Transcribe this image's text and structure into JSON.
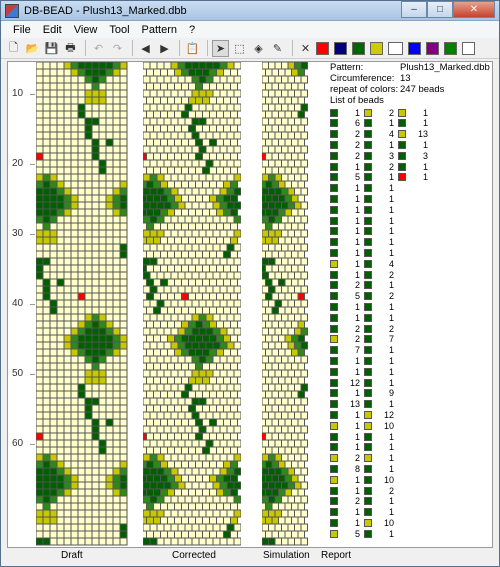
{
  "window": {
    "title": "DB-BEAD - Plush13_Marked.dbb",
    "min": "–",
    "max": "□",
    "close": "✕"
  },
  "menu": [
    {
      "id": "file",
      "label": "File"
    },
    {
      "id": "edit",
      "label": "Edit"
    },
    {
      "id": "view",
      "label": "View"
    },
    {
      "id": "tool",
      "label": "Tool"
    },
    {
      "id": "pattern",
      "label": "Pattern"
    },
    {
      "id": "help",
      "label": "?"
    }
  ],
  "toolbar": {
    "tools": [
      {
        "name": "new-icon",
        "glyph": "🗋"
      },
      {
        "name": "open-icon",
        "glyph": "📂"
      },
      {
        "name": "save-icon",
        "glyph": "💾"
      },
      {
        "name": "print-icon",
        "glyph": "🖶"
      },
      {
        "name": "undo-icon",
        "glyph": "↶",
        "disabled": true
      },
      {
        "name": "redo-icon",
        "glyph": "↷",
        "disabled": true
      },
      {
        "name": "shift-left-icon",
        "glyph": "◀"
      },
      {
        "name": "shift-right-icon",
        "glyph": "▶"
      },
      {
        "name": "paste-icon",
        "glyph": "📋",
        "disabled": true
      },
      {
        "name": "pointer-icon",
        "glyph": "➤",
        "active": true
      },
      {
        "name": "select-rect-icon",
        "glyph": "⬚"
      },
      {
        "name": "fill-icon",
        "glyph": "◈"
      },
      {
        "name": "color-picker-icon",
        "glyph": "✎"
      },
      {
        "name": "erase-icon",
        "glyph": "✕"
      }
    ],
    "palette": [
      "#ff0000",
      "#000080",
      "#006600",
      "#cccc00",
      "#ffffff",
      "#0000ff",
      "#800080",
      "#008000",
      "#ffffff"
    ]
  },
  "colors": {
    "bg": "#ffffcc",
    "dark": "#006000",
    "mid": "#2d8a1a",
    "yellow": "#c8c800",
    "red": "#ff0000",
    "grid": "#555555"
  },
  "ruler": [
    {
      "label": "60",
      "row": 15
    },
    {
      "label": "50",
      "row": 25
    },
    {
      "label": "40",
      "row": 35
    },
    {
      "label": "30",
      "row": 45
    },
    {
      "label": "20",
      "row": 55
    },
    {
      "label": "10",
      "row": 65
    }
  ],
  "report": {
    "pattern_label": "Pattern:",
    "pattern_value": "Plush13_Marked.dbb",
    "circ_label": "Circumference:",
    "circ_value": "13",
    "repeat_label": "repeat of colors:",
    "repeat_value": "247 beads",
    "list_label": "List of beads"
  },
  "bead_list": [
    [
      [
        "d",
        "1"
      ],
      [
        "d",
        "6"
      ],
      [
        "d",
        "2"
      ],
      [
        "d",
        "2"
      ],
      [
        "d",
        "2"
      ],
      [
        "d",
        "1"
      ],
      [
        "d",
        "5"
      ],
      [
        "d",
        "1"
      ],
      [
        "d",
        "1"
      ],
      [
        "d",
        "1"
      ],
      [
        "d",
        "1"
      ],
      [
        "d",
        "1"
      ],
      [
        "d",
        "1"
      ],
      [
        "d",
        "1"
      ],
      [
        "y",
        "1"
      ],
      [
        "d",
        "1"
      ],
      [
        "d",
        "2"
      ],
      [
        "d",
        "5"
      ],
      [
        "d",
        "1"
      ],
      [
        "d",
        "1"
      ],
      [
        "d",
        "2"
      ],
      [
        "y",
        "2"
      ],
      [
        "d",
        "7"
      ],
      [
        "d",
        "1"
      ],
      [
        "d",
        "1"
      ],
      [
        "d",
        "12"
      ],
      [
        "d",
        "1"
      ],
      [
        "d",
        "13"
      ],
      [
        "d",
        "1"
      ],
      [
        "y",
        "1"
      ],
      [
        "d",
        "1"
      ],
      [
        "d",
        "1"
      ],
      [
        "y",
        "2"
      ],
      [
        "d",
        "8"
      ],
      [
        "y",
        "1"
      ],
      [
        "d",
        "1"
      ],
      [
        "d",
        "2"
      ],
      [
        "d",
        "1"
      ],
      [
        "d",
        "1"
      ],
      [
        "y",
        "5"
      ]
    ],
    [
      [
        "y",
        "2"
      ],
      [
        "d",
        "1"
      ],
      [
        "d",
        "4"
      ],
      [
        "d",
        "1"
      ],
      [
        "d",
        "3"
      ],
      [
        "d",
        "2"
      ],
      [
        "d",
        "1"
      ],
      [
        "d",
        "1"
      ],
      [
        "d",
        "1"
      ],
      [
        "d",
        "1"
      ],
      [
        "d",
        "1"
      ],
      [
        "d",
        "1"
      ],
      [
        "d",
        "1"
      ],
      [
        "d",
        "1"
      ],
      [
        "d",
        "4"
      ],
      [
        "d",
        "2"
      ],
      [
        "d",
        "1"
      ],
      [
        "d",
        "2"
      ],
      [
        "d",
        "1"
      ],
      [
        "d",
        "1"
      ],
      [
        "d",
        "2"
      ],
      [
        "d",
        "7"
      ],
      [
        "d",
        "1"
      ],
      [
        "d",
        "1"
      ],
      [
        "d",
        "1"
      ],
      [
        "d",
        "1"
      ],
      [
        "d",
        "9"
      ],
      [
        "d",
        "1"
      ],
      [
        "y",
        "12"
      ],
      [
        "y",
        "10"
      ],
      [
        "d",
        "1"
      ],
      [
        "d",
        "1"
      ],
      [
        "y",
        "1"
      ],
      [
        "d",
        "1"
      ],
      [
        "d",
        "10"
      ],
      [
        "d",
        "2"
      ],
      [
        "d",
        "1"
      ],
      [
        "d",
        "1"
      ],
      [
        "y",
        "10"
      ],
      [
        "d",
        "1"
      ]
    ],
    [
      [
        "y",
        "1"
      ],
      [
        "d",
        "1"
      ],
      [
        "y",
        "13"
      ],
      [
        "d",
        "1"
      ],
      [
        "d",
        "3"
      ],
      [
        "d",
        "1"
      ],
      [
        "r",
        "1"
      ]
    ]
  ],
  "views": [
    {
      "id": "draft",
      "label": "Draft"
    },
    {
      "id": "corrected",
      "label": "Corrected"
    },
    {
      "id": "simulation",
      "label": "Simulation"
    },
    {
      "id": "report",
      "label": "Report"
    }
  ]
}
